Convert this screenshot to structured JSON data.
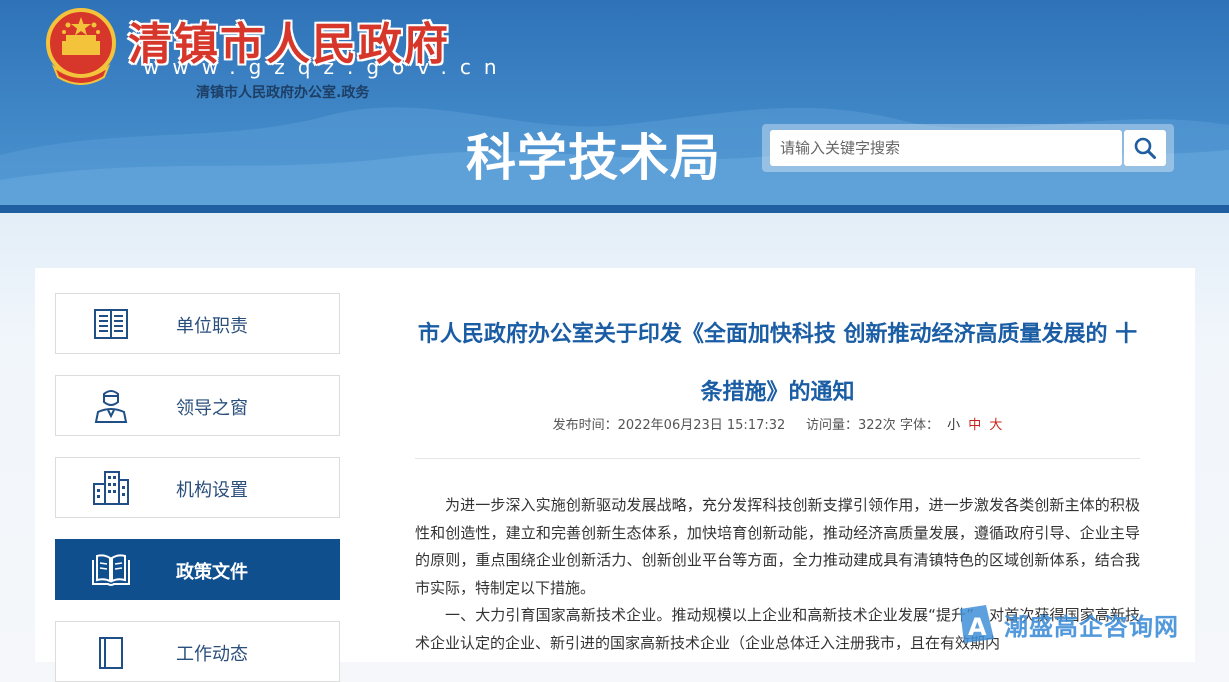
{
  "header": {
    "site_title": "清镇市人民政府",
    "site_url": "www.gzqz.gov.cn",
    "site_subtitle": "清镇市人民政府办公室.政务",
    "department": "科学技术局"
  },
  "search": {
    "placeholder": "请输入关键字搜索",
    "icon": "search-icon"
  },
  "sidebar": {
    "items": [
      {
        "label": "单位职责",
        "icon": "document-list-icon",
        "active": false
      },
      {
        "label": "领导之窗",
        "icon": "person-icon",
        "active": false
      },
      {
        "label": "机构设置",
        "icon": "building-icon",
        "active": false
      },
      {
        "label": "政策文件",
        "icon": "open-book-icon",
        "active": true
      },
      {
        "label": "工作动态",
        "icon": "notebook-icon",
        "active": false
      }
    ]
  },
  "article": {
    "title": "市人民政府办公室关于印发《全面加快科技 创新推动经济高质量发展的 十条措施》的通知",
    "meta": {
      "publish_label": "发布时间：",
      "publish_time": "2022年06月23日 15:17:32",
      "views_label": "访问量：",
      "views": "322次",
      "font_label": "字体：",
      "sizes": [
        "小",
        "中",
        "大"
      ]
    },
    "paragraphs": [
      "为进一步深入实施创新驱动发展战略，充分发挥科技创新支撑引领作用，进一步激发各类创新主体的积极性和创造性，建立和完善创新生态体系，加快培育创新动能，推动经济高质量发展，遵循政府引导、企业主导的原则，重点围绕企业创新活力、创新创业平台等方面，全力推动建成具有清镇特色的区域创新体系，结合我市实际，特制定以下措施。",
      "一、大力引育国家高新技术企业。推动规模以上企业和高新技术企业发展“提升”，对首次获得国家高新技术企业认定的企业、新引进的国家高新技术企业（企业总体迁入注册我市，且在有效期内"
    ]
  },
  "watermark": {
    "text": "潮盛高企咨询网",
    "badge": "A"
  },
  "colors": {
    "header_blue": "#3f86c6",
    "title_red": "#d6372a",
    "active_nav": "#0f4f8e",
    "article_title": "#1a5da4"
  }
}
